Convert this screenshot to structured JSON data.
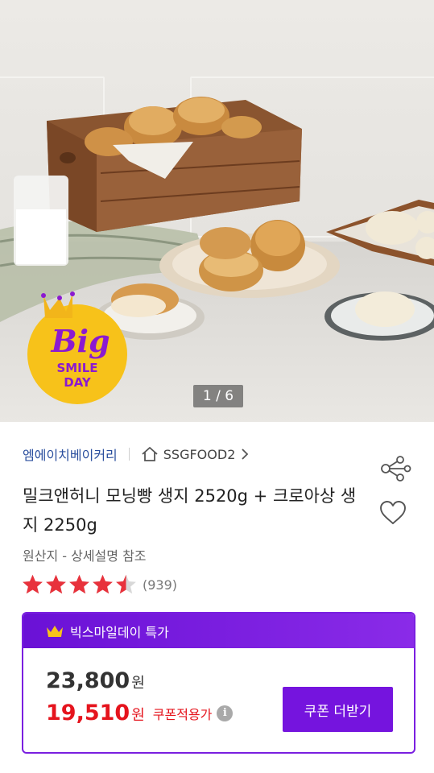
{
  "hero": {
    "counter": "1 / 6",
    "badge": {
      "line1": "Big",
      "line2": "SMILE",
      "line3": "DAY"
    }
  },
  "product": {
    "brand": "엠에이치베이커리",
    "store": "SSGFOOD2",
    "title": "밀크앤허니 모닝빵 생지 2520g + 크로아상 생지 2250g",
    "origin": "원산지 - 상세설명 참조",
    "rating_value": 4.5,
    "review_count": "(939)"
  },
  "price_card": {
    "banner_label": "빅스마일데이 특가",
    "original_price": "23,800",
    "original_unit": "원",
    "sale_price": "19,510",
    "sale_unit": "원",
    "sale_label": "쿠폰적용가",
    "info_glyph": "i",
    "coupon_button": "쿠폰 더받기"
  },
  "colors": {
    "accent_purple": "#7514de",
    "sale_red": "#e5141d",
    "star_red": "#e8323c",
    "brand_blue": "#2b4f9e",
    "badge_yellow": "#f7c21a",
    "badge_purple": "#8b1ad0"
  },
  "icons": {
    "store": "home-icon",
    "store_chevron": "chevron-right-icon",
    "share": "share-icon",
    "like": "heart-icon",
    "banner": "crown-icon",
    "star": "star-icon"
  }
}
